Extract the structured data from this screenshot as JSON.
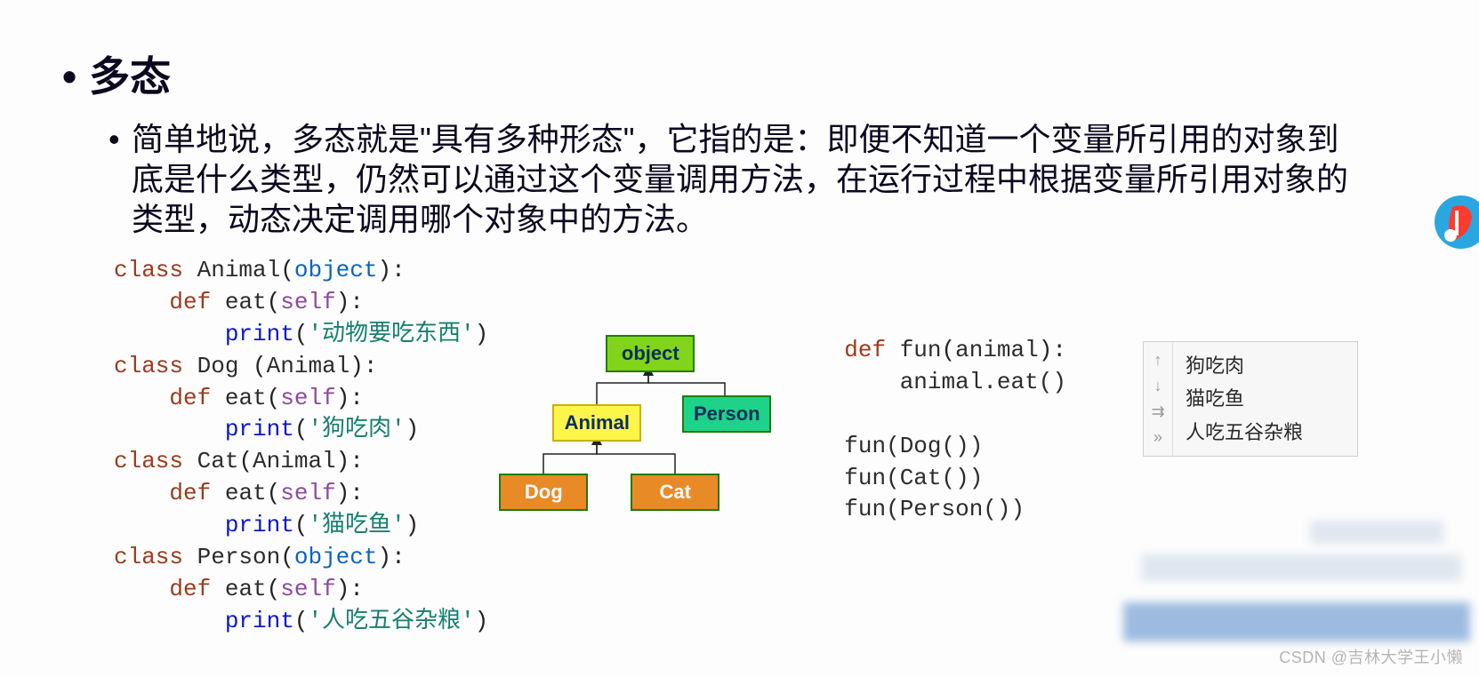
{
  "heading": "多态",
  "description": "简单地说，多态就是\"具有多种形态\"，它指的是：即便不知道一个变量所引用的对象到底是什么类型，仍然可以通过这个变量调用方法，在运行过程中根据变量所引用对象的类型，动态决定调用哪个对象中的方法。",
  "code_left": {
    "classes": [
      {
        "name": "Animal",
        "base": "object",
        "method": "eat",
        "arg": "self",
        "print_str": "'动物要吃东西'"
      },
      {
        "name": "Dog",
        "base": "Animal",
        "space_after_name": true,
        "method": "eat",
        "arg": "self",
        "print_str": "'狗吃肉'"
      },
      {
        "name": "Cat",
        "base": "Animal",
        "method": "eat",
        "arg": "self",
        "print_str": "'猫吃鱼'"
      },
      {
        "name": "Person",
        "base": "object",
        "method": "eat",
        "arg": "self",
        "print_str": "'人吃五谷杂粮'"
      }
    ]
  },
  "diagram": {
    "nodes": {
      "object": "object",
      "animal": "Animal",
      "person": "Person",
      "dog": "Dog",
      "cat": "Cat"
    }
  },
  "code_right": {
    "def_name": "fun",
    "def_arg": "animal",
    "body": "animal.eat()",
    "calls": [
      "fun(Dog())",
      "fun(Cat())",
      "fun(Person())"
    ]
  },
  "output": {
    "lines": [
      "狗吃肉",
      "猫吃鱼",
      "人吃五谷杂粮"
    ]
  },
  "watermark": "CSDN @吉林大学王小懒"
}
